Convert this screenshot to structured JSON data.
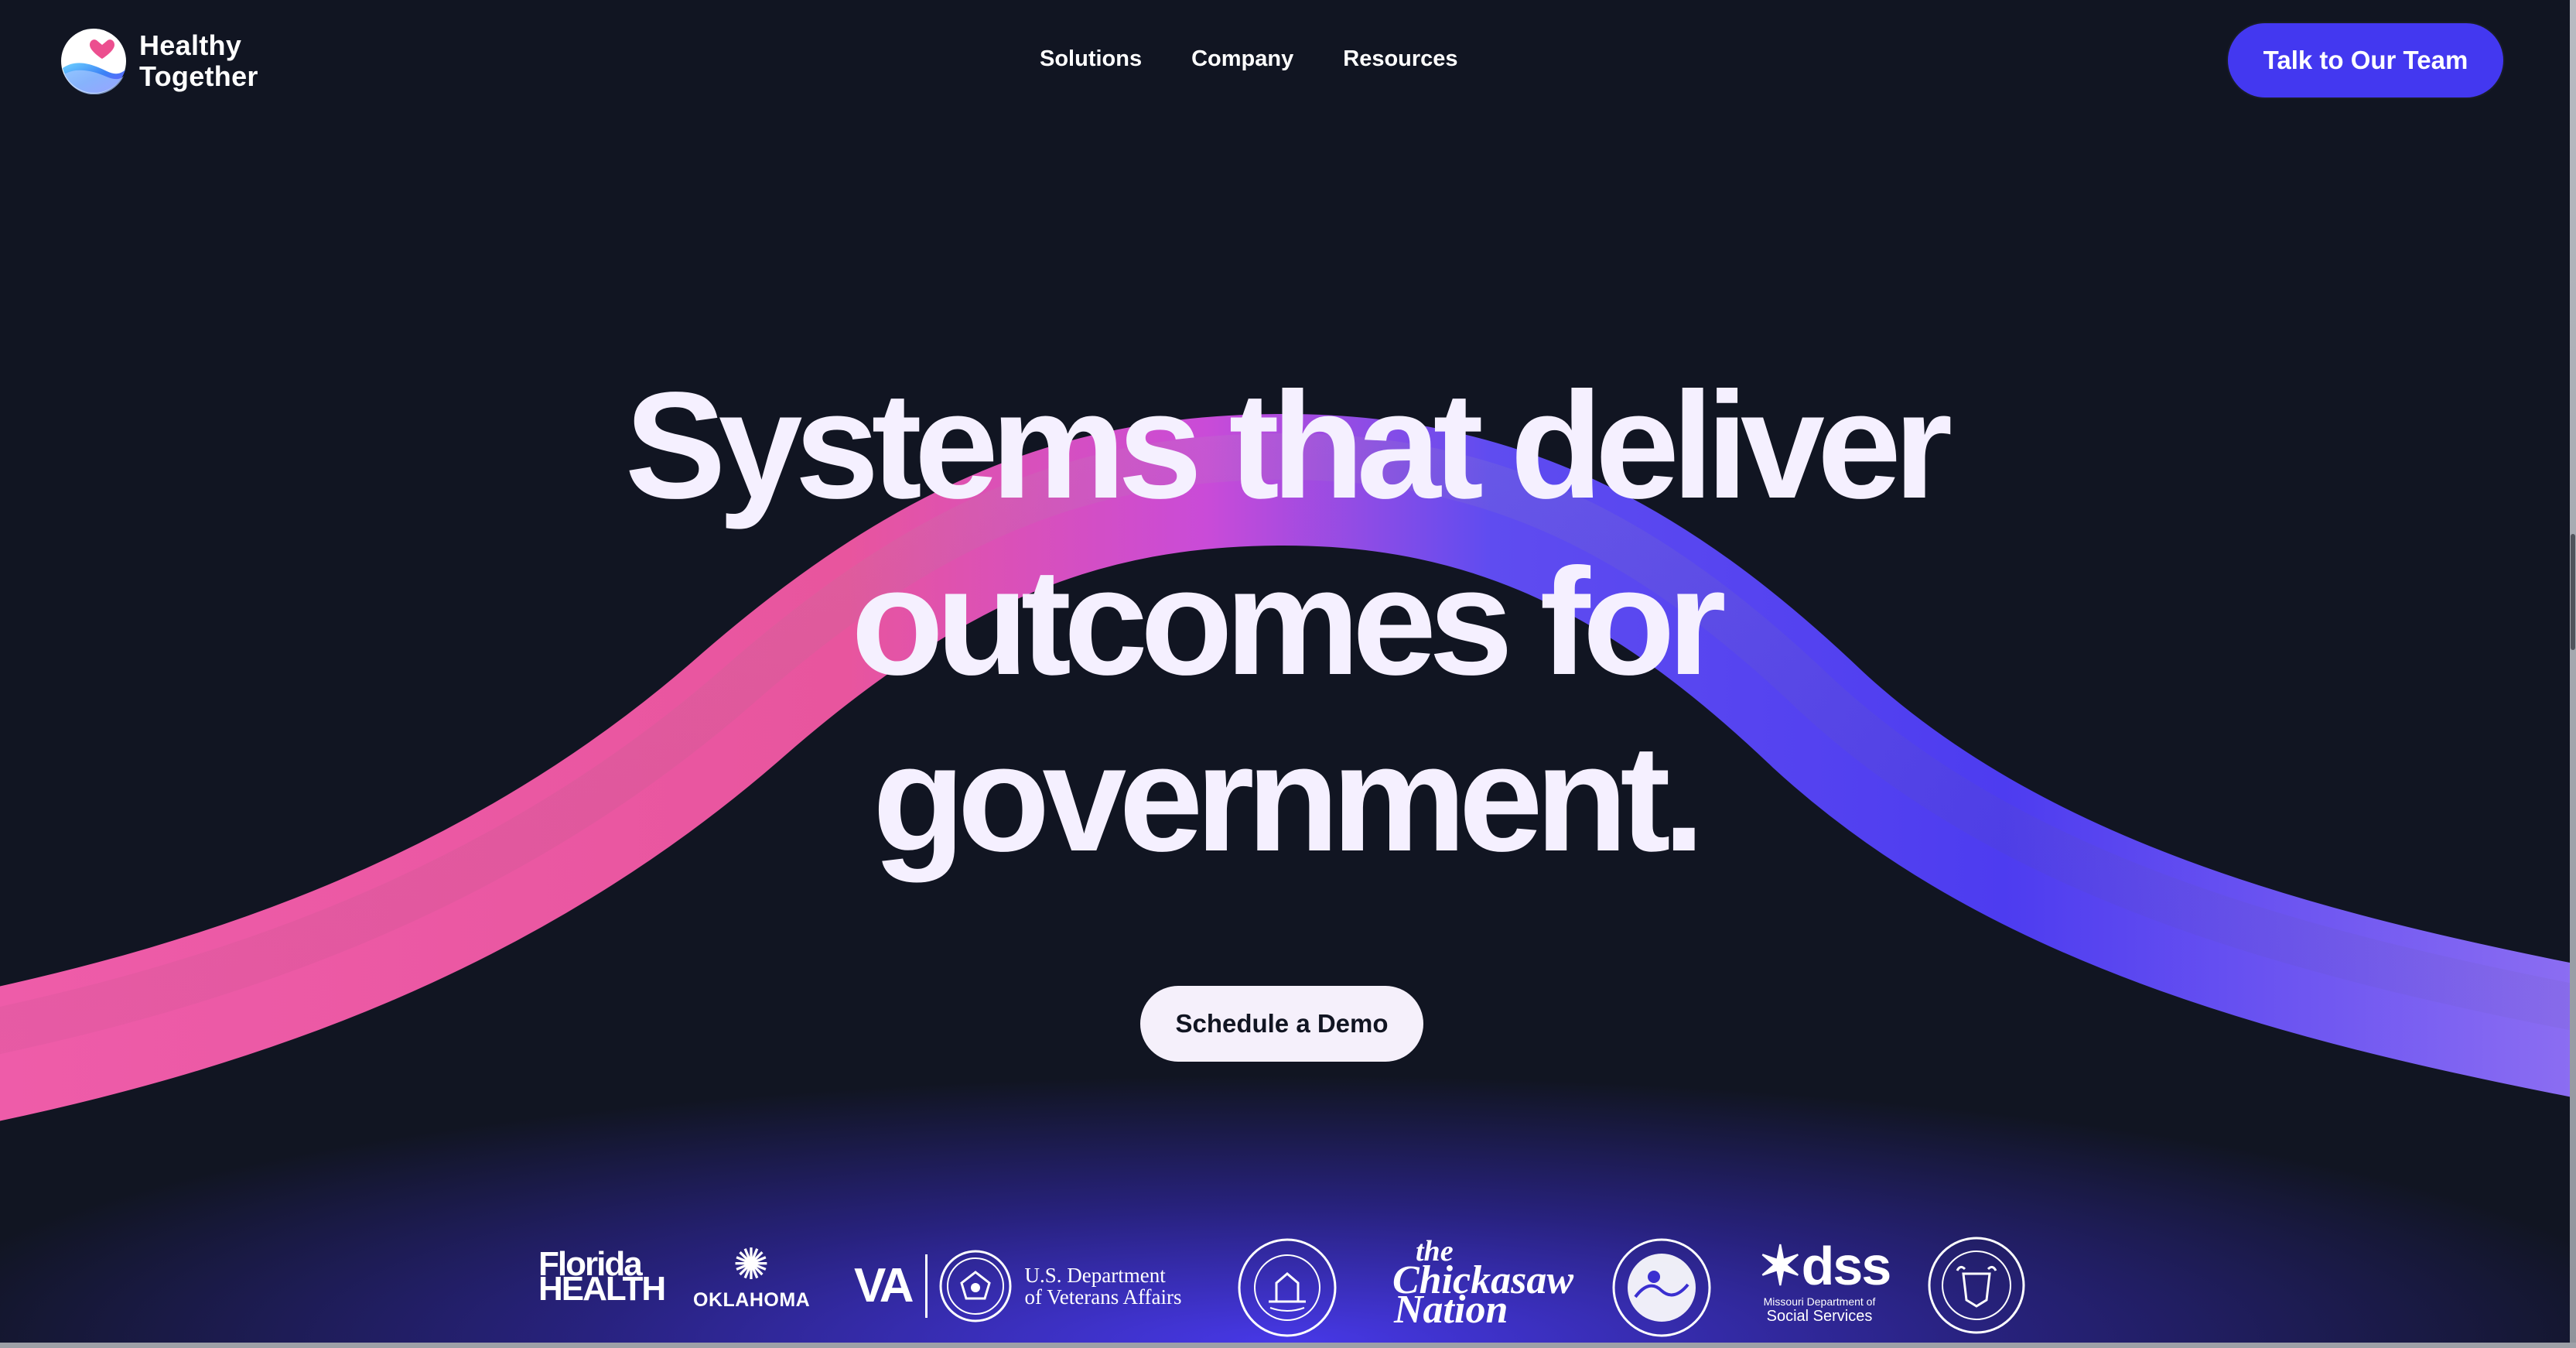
{
  "brand": {
    "line1": "Healthy",
    "line2": "Together",
    "accent": "#ec4f8f",
    "primary": "#4338f0"
  },
  "nav": {
    "items": [
      "Solutions",
      "Company",
      "Resources"
    ]
  },
  "header": {
    "cta_label": "Talk to Our Team"
  },
  "hero": {
    "line1": "Systems that deliver",
    "line2": "outcomes for",
    "line3": "government.",
    "cta_label": "Schedule a Demo"
  },
  "partners": {
    "florida": {
      "line1": "Florida",
      "line2": "HEALTH"
    },
    "oklahoma": {
      "name": "OKLAHOMA"
    },
    "va": {
      "abbr": "VA",
      "line1": "U.S. Department",
      "line2": "of Veterans Affairs"
    },
    "maryland_agriculture": {
      "name": "MARYLAND DEPARTMENT OF AGRICULTURE"
    },
    "chickasaw": {
      "line1": "the",
      "line2": "Chickasaw",
      "line3": "Nation"
    },
    "maryland_market_money": {
      "name": "Maryland Market Money"
    },
    "missouri": {
      "abbr": "dss",
      "line1": "Missouri Department of",
      "line2": "Social Services"
    },
    "michigan": {
      "name": "THE GREAT SEAL OF THE STATE OF MICHIGAN"
    }
  },
  "colors": {
    "background": "#111522",
    "wave_pink": "#e9559f",
    "wave_violet": "#5b4cf0",
    "headline": "#f5f0ff"
  }
}
